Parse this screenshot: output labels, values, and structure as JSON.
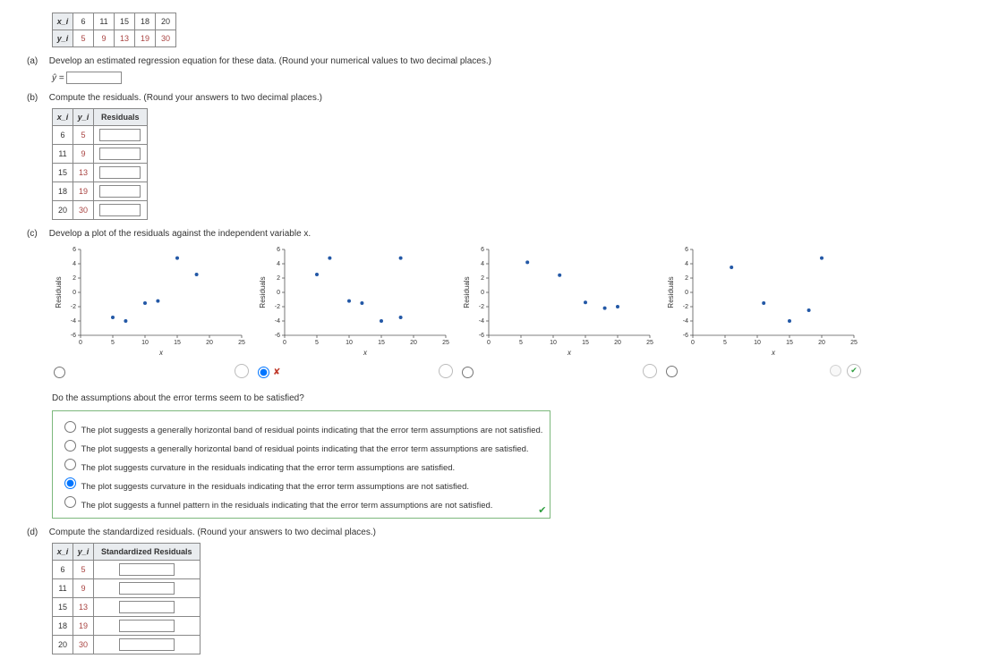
{
  "dataTable": {
    "headers": [
      "x_i",
      "y_i"
    ],
    "cols": [
      "6",
      "11",
      "15",
      "18",
      "20"
    ],
    "yvals": [
      "5",
      "9",
      "13",
      "19",
      "30"
    ]
  },
  "partA": {
    "label": "(a)",
    "text": "Develop an estimated regression equation for these data. (Round your numerical values to two decimal places.)",
    "yhat": "ŷ ="
  },
  "partB": {
    "label": "(b)",
    "text": "Compute the residuals. (Round your answers to two decimal places.)",
    "headers": [
      "x_i",
      "y_i",
      "Residuals"
    ],
    "rows": [
      {
        "x": "6",
        "y": "5"
      },
      {
        "x": "11",
        "y": "9"
      },
      {
        "x": "15",
        "y": "13"
      },
      {
        "x": "18",
        "y": "19"
      },
      {
        "x": "20",
        "y": "30"
      }
    ]
  },
  "partC": {
    "label": "(c)",
    "text": "Develop a plot of the residuals against the independent variable x.",
    "xlabel": "x",
    "ylabel": "Residuals",
    "xticks": [
      0,
      5,
      10,
      15,
      20,
      25
    ],
    "yticks": [
      -6,
      -4,
      -2,
      0,
      2,
      4,
      6
    ],
    "selected": 1,
    "correct": 3,
    "question": "Do the assumptions about the error terms seem to be satisfied?",
    "options": [
      "The plot suggests a generally horizontal band of residual points indicating that the error term assumptions are not satisfied.",
      "The plot suggests a generally horizontal band of residual points indicating that the error term assumptions are satisfied.",
      "The plot suggests curvature in the residuals indicating that the error term assumptions are satisfied.",
      "The plot suggests curvature in the residuals indicating that the error term assumptions are not satisfied.",
      "The plot suggests a funnel pattern in the residuals indicating that the error term assumptions are not satisfied."
    ],
    "optSelected": 3
  },
  "partD": {
    "label": "(d)",
    "text": "Compute the standardized residuals. (Round your answers to two decimal places.)",
    "headers": [
      "x_i",
      "y_i",
      "Standardized Residuals"
    ],
    "rows": [
      {
        "x": "6",
        "y": "5"
      },
      {
        "x": "11",
        "y": "9"
      },
      {
        "x": "15",
        "y": "13"
      },
      {
        "x": "18",
        "y": "19"
      },
      {
        "x": "20",
        "y": "30"
      }
    ]
  },
  "chart_data": [
    {
      "type": "scatter",
      "xlabel": "x",
      "ylabel": "Residuals",
      "xlim": [
        0,
        25
      ],
      "ylim": [
        -6,
        6
      ],
      "points": [
        [
          5,
          -3.5
        ],
        [
          7,
          -4
        ],
        [
          10,
          -1.5
        ],
        [
          12,
          -1.2
        ],
        [
          15,
          4.8
        ],
        [
          18,
          2.5
        ]
      ]
    },
    {
      "type": "scatter",
      "xlabel": "x",
      "ylabel": "Residuals",
      "xlim": [
        0,
        25
      ],
      "ylim": [
        -6,
        6
      ],
      "points": [
        [
          5,
          2.5
        ],
        [
          7,
          4.8
        ],
        [
          10,
          -1.2
        ],
        [
          12,
          -1.5
        ],
        [
          15,
          -4
        ],
        [
          18,
          -3.5
        ],
        [
          18,
          4.8
        ]
      ]
    },
    {
      "type": "scatter",
      "xlabel": "x",
      "ylabel": "Residuals",
      "xlim": [
        0,
        25
      ],
      "ylim": [
        -6,
        6
      ],
      "points": [
        [
          6,
          4.2
        ],
        [
          11,
          2.4
        ],
        [
          15,
          -1.4
        ],
        [
          18,
          -2.2
        ],
        [
          20,
          -2
        ]
      ]
    },
    {
      "type": "scatter",
      "xlabel": "x",
      "ylabel": "Residuals",
      "xlim": [
        0,
        25
      ],
      "ylim": [
        -6,
        6
      ],
      "points": [
        [
          6,
          3.5
        ],
        [
          11,
          -1.5
        ],
        [
          15,
          -4
        ],
        [
          18,
          -2.5
        ],
        [
          20,
          4.8
        ]
      ]
    }
  ]
}
